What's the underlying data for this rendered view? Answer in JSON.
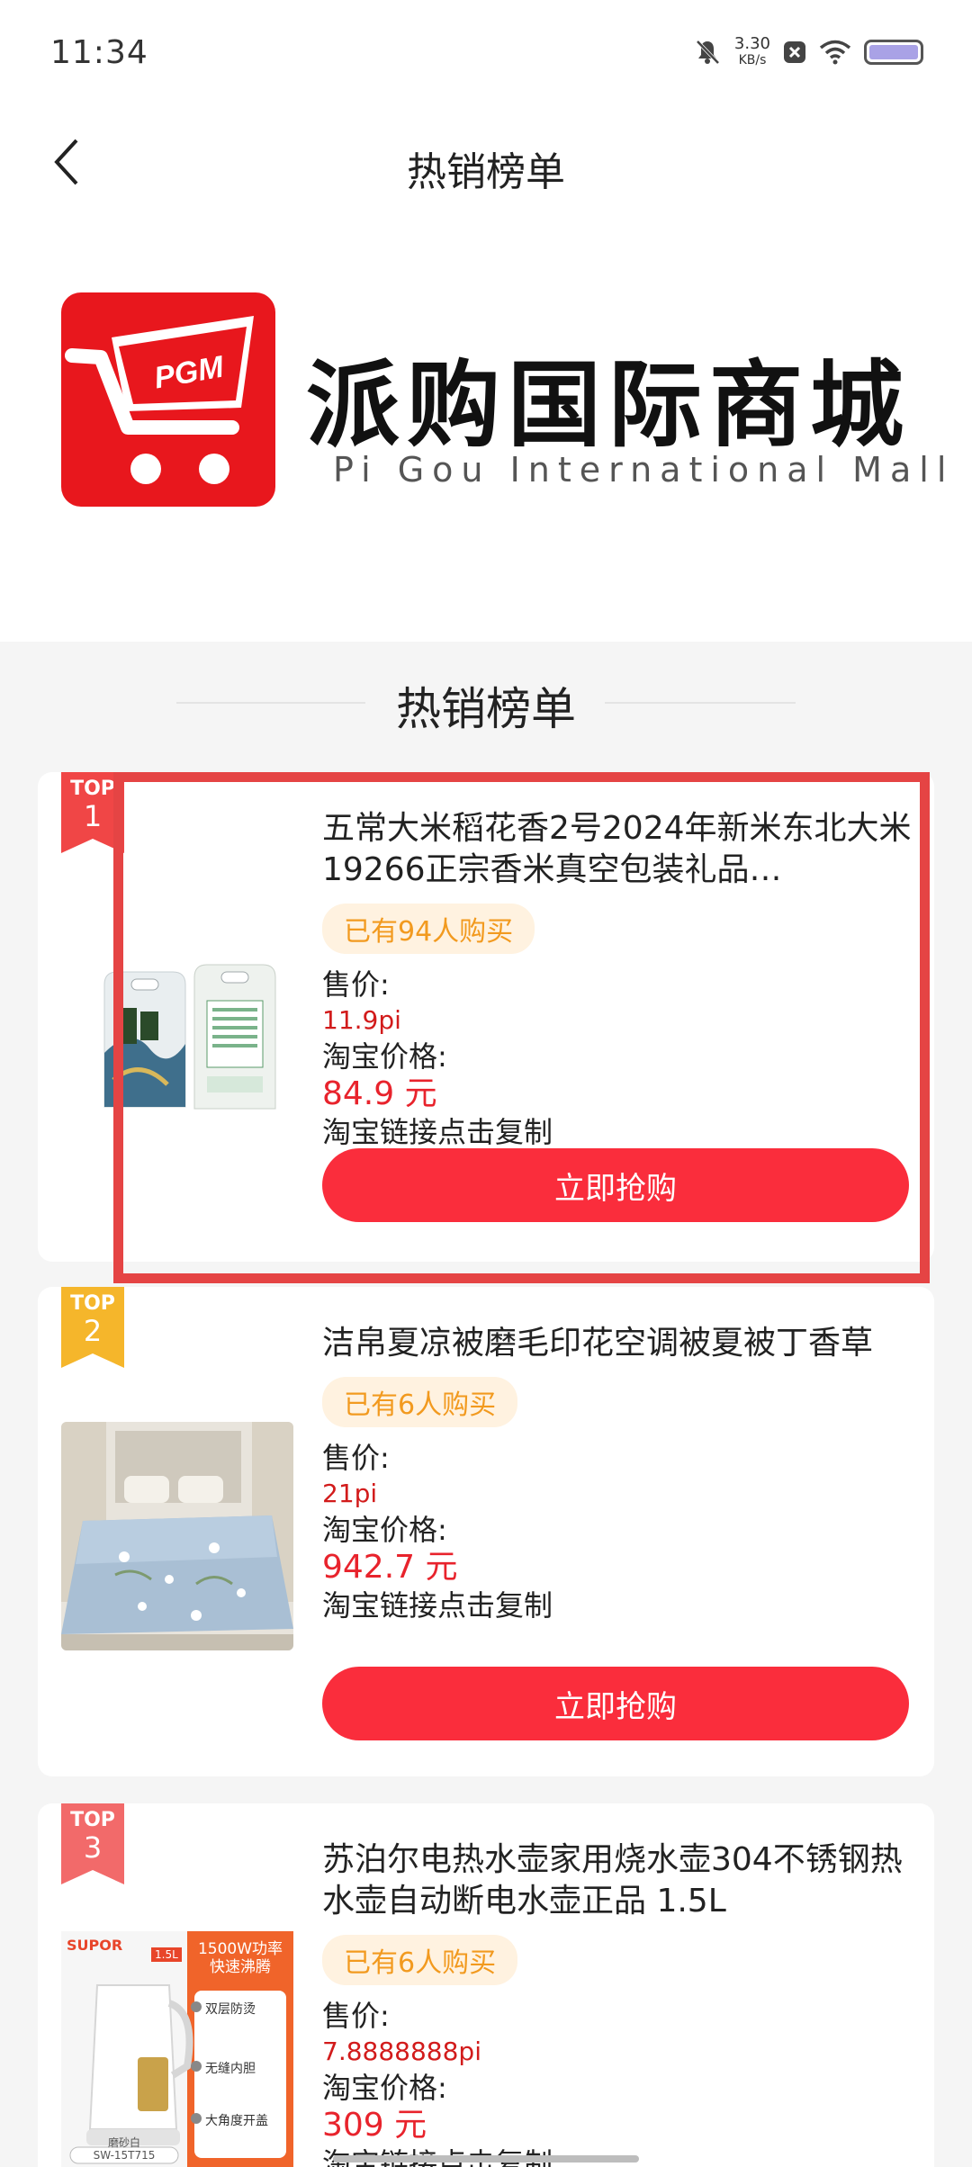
{
  "status": {
    "time": "11:34",
    "net_speed_value": "3.30",
    "net_speed_unit": "KB/s"
  },
  "header": {
    "title": "热销榜单"
  },
  "banner": {
    "logo_text": "PGM",
    "brand_cn": "派购国际商城",
    "brand_en": "Pi Gou International Mall"
  },
  "section": {
    "title": "热销榜单"
  },
  "products": [
    {
      "rank_top": "TOP",
      "rank_num": "1",
      "ribbon_color": "#f04646",
      "title": "五常大米稻花香2号2024年新米东北大米19266正宗香米真空包装礼品…",
      "sold": "已有94人购买",
      "price_label": "售价:",
      "pi_price": "11.9pi",
      "tb_label": "淘宝价格:",
      "tb_price": "84.9 元",
      "copy_text": "淘宝链接点击复制",
      "buy_label": "立即抢购"
    },
    {
      "rank_top": "TOP",
      "rank_num": "2",
      "ribbon_color": "#f5b62b",
      "title": "洁帛夏凉被磨毛印花空调被夏被丁香草",
      "sold": "已有6人购买",
      "price_label": "售价:",
      "pi_price": "21pi",
      "tb_label": "淘宝价格:",
      "tb_price": "942.7 元",
      "copy_text": "淘宝链接点击复制",
      "buy_label": "立即抢购"
    },
    {
      "rank_top": "TOP",
      "rank_num": "3",
      "ribbon_color": "#f26a6a",
      "title": "苏泊尔电热水壶家用烧水壶304不锈钢热水壶自动断电水壶正品 1.5L",
      "sold": "已有6人购买",
      "price_label": "售价:",
      "pi_price": "7.8888888pi",
      "tb_label": "淘宝价格:",
      "tb_price": "309 元",
      "copy_text": "淘宝链接点击复制",
      "buy_label": "立即抢购"
    }
  ],
  "kettle_img": {
    "brand": "SUPOR",
    "speed_line1": "1500W功率",
    "speed_line2": "快速沸腾",
    "feature1": "双层防烫",
    "feature2": "无缝内胆",
    "feature3": "大角度开盖",
    "color_name": "磨砂白",
    "model": "SW-15T715",
    "tag": "1.5L"
  },
  "colors": {
    "accent": "#fa2d3c",
    "price_red": "#e8232c",
    "badge_bg": "#fff2e0",
    "badge_text": "#f29a1f",
    "highlight": "#e54444"
  }
}
